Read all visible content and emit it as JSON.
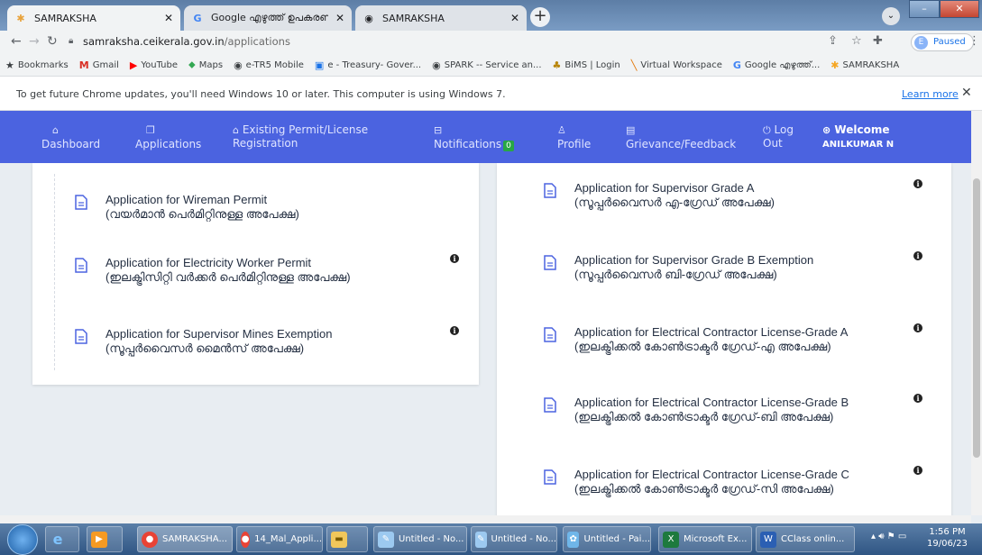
{
  "browser": {
    "tabs": [
      {
        "title": "SAMRAKSHA",
        "icon": "samraksha-icon"
      },
      {
        "title": "Google എഴുത്ത് ഉപകരണ",
        "icon": "google-icon"
      },
      {
        "title": "SAMRAKSHA",
        "icon": "globe-icon"
      }
    ],
    "url_host": "samraksha.ceikerala.gov.in",
    "url_path": "/applications",
    "profile_initial": "E",
    "profile_status": "Paused",
    "bookmarks": [
      {
        "label": "Bookmarks",
        "icon": "star-icon",
        "color": "#202124"
      },
      {
        "label": "Gmail",
        "icon": "gmail-icon",
        "color": "#d93025"
      },
      {
        "label": "YouTube",
        "icon": "youtube-icon",
        "color": "#ff0000"
      },
      {
        "label": "Maps",
        "icon": "maps-icon",
        "color": "#34a853"
      },
      {
        "label": "e-TR5 Mobile",
        "icon": "globe-icon",
        "color": "#5f6368"
      },
      {
        "label": "e - Treasury- Gover...",
        "icon": "etreasury-icon",
        "color": "#1a73e8"
      },
      {
        "label": "SPARK -- Service an...",
        "icon": "globe-icon",
        "color": "#5f6368"
      },
      {
        "label": "BiMS | Login",
        "icon": "bims-icon",
        "color": "#b8860b"
      },
      {
        "label": "Virtual Workspace",
        "icon": "workspace-icon",
        "color": "#e37400"
      },
      {
        "label": "Google എഴുത്ത്...",
        "icon": "google-icon",
        "color": "#4285f4"
      },
      {
        "label": "SAMRAKSHA",
        "icon": "samraksha-icon",
        "color": "#f5a623"
      }
    ]
  },
  "infobar": {
    "text": "To get future Chrome updates, you'll need Windows 10 or later. This computer is using Windows 7.",
    "link": "Learn more"
  },
  "nav": {
    "dashboard": "Dashboard",
    "applications": "Applications",
    "existing_permit_line1": "Existing Permit/License",
    "existing_permit_line2": "Registration",
    "notifications": "Notifications",
    "notifications_count": "0",
    "profile": "Profile",
    "grievance": "Grievance/Feedback",
    "logout_line1": "Log",
    "logout_line2": "Out",
    "welcome": "Welcome",
    "user": "ANILKUMAR N",
    "accent_color": "#4b63e0"
  },
  "left_applications": [
    {
      "title": "Application for Wireman Permit",
      "subtitle": "(വയർമാൻ പെർമിറ്റിനുള്ള അപേക്ഷ)"
    },
    {
      "title": "Application for Electricity Worker Permit",
      "subtitle": "(ഇലക്ട്രിസിറ്റി വർക്കർ പെർമിറ്റിനുള്ള അപേക്ഷ)"
    },
    {
      "title": "Application for Supervisor Mines Exemption",
      "subtitle": "(സൂപ്പർവൈസർ മൈൻസ് അപേക്ഷ)"
    }
  ],
  "right_applications": [
    {
      "title": "Application for Supervisor Grade A",
      "subtitle": "(സൂപ്പർവൈസർ എ-ഗ്രേഡ് അപേക്ഷ)"
    },
    {
      "title": "Application for Supervisor Grade B Exemption",
      "subtitle": "(സൂപ്പർവൈസർ ബി-ഗ്രേഡ് അപേക്ഷ)"
    },
    {
      "title": "Application for Electrical Contractor License-Grade A",
      "subtitle": "(ഇലക്ട്രിക്കൽ കോൺട്രാക്ടർ ഗ്രേഡ്-എ അപേക്ഷ)"
    },
    {
      "title": "Application for Electrical Contractor License-Grade B",
      "subtitle": "(ഇലക്ട്രിക്കൽ കോൺട്രാക്ടർ ഗ്രേഡ്-ബി അപേക്ഷ)"
    },
    {
      "title": "Application for Electrical Contractor License-Grade C",
      "subtitle": "(ഇലക്ട്രിക്കൽ കോൺട്രാക്ടർ ഗ്രേഡ്-സി അപേക്ഷ)"
    }
  ],
  "taskbar": {
    "items": [
      "SAMRAKSHA...",
      "14_Mal_Appli...",
      "",
      "Untitled - No...",
      "Untitled - No...",
      "Untitled - Pai...",
      "Microsoft Ex...",
      "CClass onlin..."
    ],
    "time": "1:56 PM",
    "date": "19/06/23"
  }
}
